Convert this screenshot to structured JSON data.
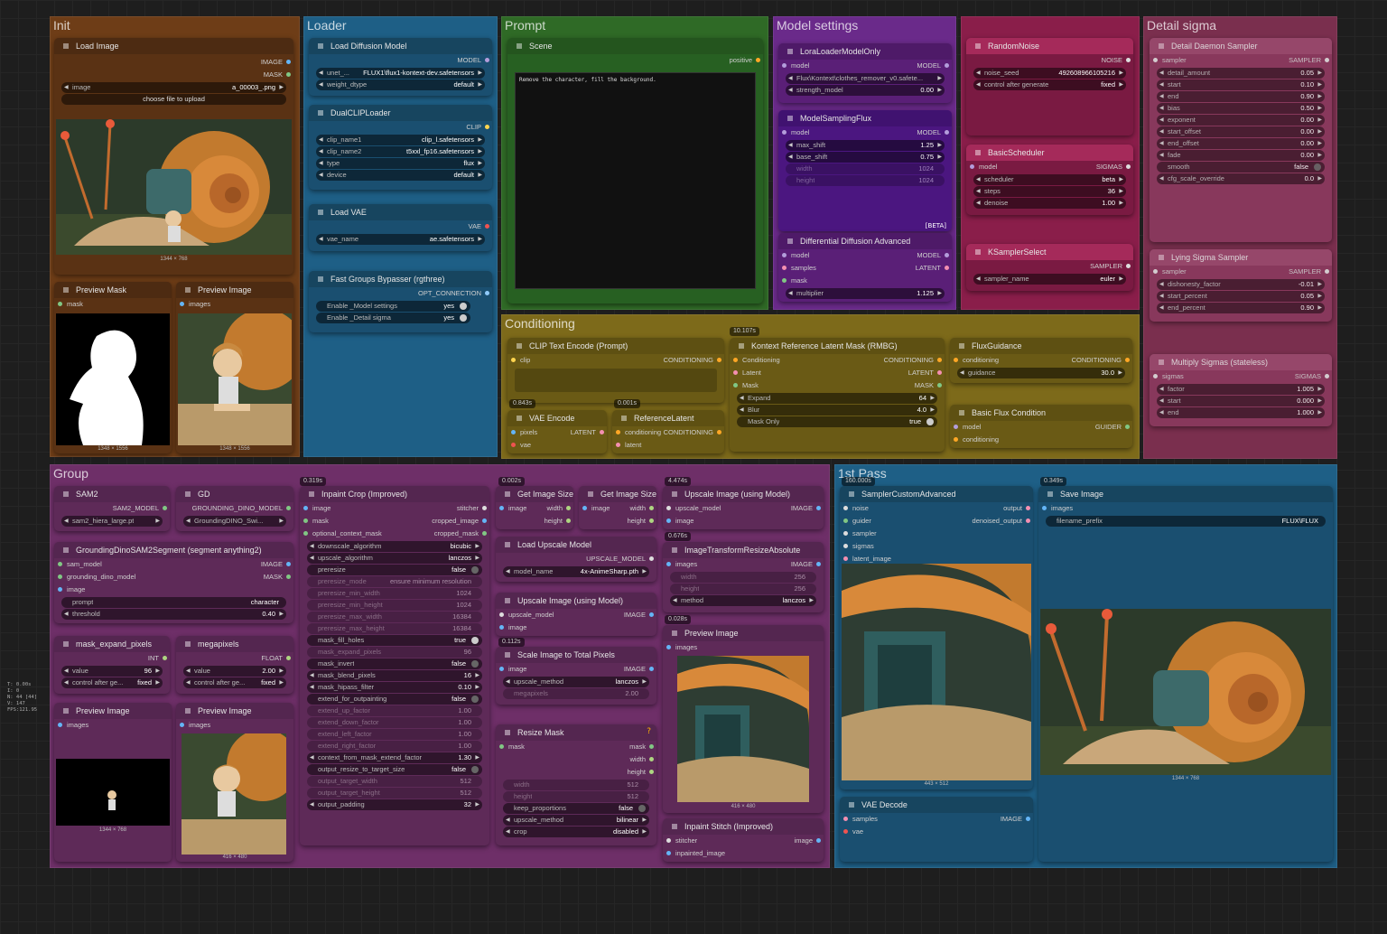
{
  "groups": {
    "init": "Init",
    "loader": "Loader",
    "prompt": "Prompt",
    "model_settings": "Model settings",
    "detail_sigma": "Detail sigma",
    "conditioning": "Conditioning",
    "group": "Group",
    "first_pass": "1st Pass"
  },
  "nodes": {
    "load_image": {
      "title": "Load Image",
      "out1": "IMAGE",
      "out2": "MASK",
      "image_key": "image",
      "image_val": "a_00003_.png",
      "upload": "choose file to upload",
      "cap": "1344 × 768"
    },
    "preview_mask": {
      "title": "Preview Mask",
      "in": "mask",
      "cap": "1348 × 1556"
    },
    "preview_image_init": {
      "title": "Preview Image",
      "in": "images",
      "cap": "1348 × 1556"
    },
    "load_diffusion": {
      "title": "Load Diffusion Model",
      "out": "MODEL",
      "w1k": "unet_...",
      "w1v": "FLUX1\\flux1-kontext-dev.safetensors",
      "w2k": "weight_dtype",
      "w2v": "default"
    },
    "dual_clip": {
      "title": "DualCLIPLoader",
      "out": "CLIP",
      "w1k": "clip_name1",
      "w1v": "clip_l.safetensors",
      "w2k": "clip_name2",
      "w2v": "t5xxl_fp16.safetensors",
      "w3k": "type",
      "w3v": "flux",
      "w4k": "device",
      "w4v": "default"
    },
    "load_vae": {
      "title": "Load VAE",
      "out": "VAE",
      "w1k": "vae_name",
      "w1v": "ae.safetensors"
    },
    "bypasser": {
      "title": "Fast Groups Bypasser (rgthree)",
      "out": "OPT_CONNECTION",
      "w1k": "Enable _Model settings",
      "w1v": "yes",
      "w2k": "Enable _Detail sigma",
      "w2v": "yes"
    },
    "scene": {
      "title": "Scene",
      "out": "positive",
      "text": "Remove the character, fill the background."
    },
    "lora": {
      "title": "LoraLoaderModelOnly",
      "in": "model",
      "out": "MODEL",
      "w1v": "Flux\\Kontext\\clothes_remover_v0.safete...",
      "w2k": "strength_model",
      "w2v": "0.00"
    },
    "msf": {
      "title": "ModelSamplingFlux",
      "in": "model",
      "out": "MODEL",
      "w1k": "max_shift",
      "w1v": "1.25",
      "w2k": "base_shift",
      "w2v": "0.75",
      "w3k": "width",
      "w3v": "1024",
      "w4k": "height",
      "w4v": "1024",
      "beta": "[BETA]"
    },
    "dda": {
      "title": "Differential Diffusion Advanced",
      "in1": "model",
      "in2": "samples",
      "in3": "mask",
      "out1": "MODEL",
      "out2": "LATENT",
      "w1k": "multiplier",
      "w1v": "1.125"
    },
    "random_noise": {
      "title": "RandomNoise",
      "out": "NOISE",
      "w1k": "noise_seed",
      "w1v": "492608966105216",
      "w2k": "control after generate",
      "w2v": "fixed"
    },
    "basic_sched": {
      "title": "BasicScheduler",
      "in": "model",
      "out": "SIGMAS",
      "w1k": "scheduler",
      "w1v": "beta",
      "w2k": "steps",
      "w2v": "36",
      "w3k": "denoise",
      "w3v": "1.00"
    },
    "ksampler_sel": {
      "title": "KSamplerSelect",
      "out": "SAMPLER",
      "w1k": "sampler_name",
      "w1v": "euler"
    },
    "ddsampler": {
      "title": "Detail Daemon Sampler",
      "in": "sampler",
      "out": "SAMPLER",
      "rows": [
        [
          "detail_amount",
          "0.05"
        ],
        [
          "start",
          "0.10"
        ],
        [
          "end",
          "0.90"
        ],
        [
          "bias",
          "0.50"
        ],
        [
          "exponent",
          "0.00"
        ],
        [
          "start_offset",
          "0.00"
        ],
        [
          "end_offset",
          "0.00"
        ],
        [
          "fade",
          "0.00"
        ]
      ],
      "smooth_k": "smooth",
      "smooth_v": "false",
      "cfg_k": "cfg_scale_override",
      "cfg_v": "0.0"
    },
    "lying": {
      "title": "Lying Sigma Sampler",
      "in": "sampler",
      "out": "SAMPLER",
      "w1k": "dishonesty_factor",
      "w1v": "-0.01",
      "w2k": "start_percent",
      "w2v": "0.05",
      "w3k": "end_percent",
      "w3v": "0.90"
    },
    "mult": {
      "title": "Multiply Sigmas (stateless)",
      "in": "sigmas",
      "out": "SIGMAS",
      "w1k": "factor",
      "w1v": "1.005",
      "w2k": "start",
      "w2v": "0.000",
      "w3k": "end",
      "w3v": "1.000"
    },
    "clip_enc": {
      "title": "CLIP Text Encode (Prompt)",
      "in": "clip",
      "out": "CONDITIONING"
    },
    "vae_enc": {
      "title": "VAE Encode",
      "in1": "pixels",
      "in2": "vae",
      "out": "LATENT"
    },
    "ref_latent": {
      "title": "ReferenceLatent",
      "in1": "conditioning",
      "in2": "latent",
      "out": "CONDITIONING"
    },
    "kontext_mask": {
      "title": "Kontext Reference Latent Mask (RMBG)",
      "in1": "Conditioning",
      "in2": "Latent",
      "in3": "Mask",
      "out1": "CONDITIONING",
      "out2": "LATENT",
      "out3": "MASK",
      "w1k": "Expand",
      "w1v": "64",
      "w2k": "Blur",
      "w2v": "4.0",
      "w3k": "Mask Only",
      "w3v": "true"
    },
    "flux_guid": {
      "title": "FluxGuidance",
      "in": "conditioning",
      "out": "CONDITIONING",
      "w1k": "guidance",
      "w1v": "30.0"
    },
    "basic_flux": {
      "title": "Basic Flux Condition",
      "in1": "model",
      "in2": "conditioning",
      "out": "GUIDER"
    },
    "sam2": {
      "title": "SAM2",
      "out": "SAM2_MODEL",
      "w1v": "sam2_hiera_large.pt"
    },
    "gd": {
      "title": "GD",
      "out": "GROUNDING_DINO_MODEL",
      "w1v": "GroundingDINO_Swi..."
    },
    "gdsam": {
      "title": "GroundingDinoSAM2Segment (segment anything2)",
      "in1": "sam_model",
      "in2": "grounding_dino_model",
      "in3": "image",
      "out1": "IMAGE",
      "out2": "MASK",
      "w1k": "prompt",
      "w1v": "character",
      "w2k": "threshold",
      "w2v": "0.40"
    },
    "mask_expand": {
      "title": "mask_expand_pixels",
      "out": "INT",
      "w1k": "value",
      "w1v": "96",
      "w2k": "control after ge...",
      "w2v": "fixed"
    },
    "megapixels": {
      "title": "megapixels",
      "out": "FLOAT",
      "w1k": "value",
      "w1v": "2.00",
      "w2k": "control after ge...",
      "w2v": "fixed"
    },
    "prev_g1": {
      "title": "Preview Image",
      "in": "images",
      "cap": "1344 × 768"
    },
    "prev_g2": {
      "title": "Preview Image",
      "in": "images",
      "cap": "416 × 480"
    },
    "inpaint_crop": {
      "title": "Inpaint Crop (Improved)",
      "in1": "image",
      "in2": "mask",
      "in3": "optional_context_mask",
      "out1": "stitcher",
      "out2": "cropped_image",
      "out3": "cropped_mask",
      "rows": [
        [
          "downscale_algorithm",
          "bicubic",
          "n"
        ],
        [
          "upscale_algorithm",
          "lanczos",
          "n"
        ],
        [
          "preresize",
          "false",
          "t"
        ],
        [
          "preresize_mode",
          "ensure minimum resolution",
          "d"
        ],
        [
          "preresize_min_width",
          "1024",
          "d"
        ],
        [
          "preresize_min_height",
          "1024",
          "d"
        ],
        [
          "preresize_max_width",
          "16384",
          "d"
        ],
        [
          "preresize_max_height",
          "16384",
          "d"
        ],
        [
          "mask_fill_holes",
          "true",
          "t"
        ],
        [
          "mask_expand_pixels",
          "96",
          "d"
        ],
        [
          "mask_invert",
          "false",
          "t"
        ],
        [
          "mask_blend_pixels",
          "16",
          "n"
        ],
        [
          "mask_hipass_filter",
          "0.10",
          "n"
        ],
        [
          "extend_for_outpainting",
          "false",
          "t"
        ],
        [
          "extend_up_factor",
          "1.00",
          "d"
        ],
        [
          "extend_down_factor",
          "1.00",
          "d"
        ],
        [
          "extend_left_factor",
          "1.00",
          "d"
        ],
        [
          "extend_right_factor",
          "1.00",
          "d"
        ],
        [
          "context_from_mask_extend_factor",
          "1.30",
          "n"
        ],
        [
          "output_resize_to_target_size",
          "false",
          "t"
        ],
        [
          "output_target_width",
          "512",
          "d"
        ],
        [
          "output_target_height",
          "512",
          "d"
        ],
        [
          "output_padding",
          "32",
          "n"
        ]
      ]
    },
    "gis1": {
      "title": "Get Image Size",
      "in": "image",
      "out1": "width",
      "out2": "height"
    },
    "gis2": {
      "title": "Get Image Size",
      "in": "image",
      "out1": "width",
      "out2": "height"
    },
    "upscale_model": {
      "title": "Upscale Image (using Model)",
      "in1": "upscale_model",
      "in2": "image",
      "out": "IMAGE"
    },
    "load_upscale": {
      "title": "Load Upscale Model",
      "out": "UPSCALE_MODEL",
      "w1k": "model_name",
      "w1v": "4x-AnimeSharp.pth"
    },
    "itra": {
      "title": "ImageTransformResizeAbsolute",
      "in": "images",
      "out": "IMAGE",
      "w1k": "width",
      "w1v": "256",
      "w2k": "height",
      "w2v": "256",
      "w3k": "method",
      "w3v": "lanczos"
    },
    "upscale_model2": {
      "title": "Upscale Image (using Model)",
      "in1": "upscale_model",
      "in2": "image",
      "out": "IMAGE"
    },
    "scale_total": {
      "title": "Scale Image to Total Pixels",
      "in": "image",
      "out": "IMAGE",
      "w1k": "upscale_method",
      "w1v": "lanczos",
      "w2k": "megapixels",
      "w2v": "2.00"
    },
    "prev_g3": {
      "title": "Preview Image",
      "in": "images",
      "cap": "416 × 480"
    },
    "resize_mask": {
      "title": "Resize Mask",
      "in": "mask",
      "out1": "mask",
      "out2": "width",
      "out3": "height",
      "w1k": "width",
      "w1v": "512",
      "w2k": "height",
      "w2v": "512",
      "w3k": "keep_proportions",
      "w3v": "false",
      "w4k": "upscale_method",
      "w4v": "bilinear",
      "w5k": "crop",
      "w5v": "disabled",
      "q": "?"
    },
    "inpaint_stitch": {
      "title": "Inpaint Stitch (Improved)",
      "in1": "stitcher",
      "in2": "inpainted_image",
      "out": "image"
    },
    "sca": {
      "title": "SamplerCustomAdvanced",
      "in1": "noise",
      "in2": "guider",
      "in3": "sampler",
      "in4": "sigmas",
      "in5": "latent_image",
      "out1": "output",
      "out2": "denoised_output",
      "cap": "443 × 512"
    },
    "vae_dec": {
      "title": "VAE Decode",
      "in1": "samples",
      "in2": "vae",
      "out": "IMAGE"
    },
    "save": {
      "title": "Save Image",
      "in": "images",
      "w1k": "filename_prefix",
      "w1v": "FLUX\\FLUX",
      "cap": "1344 × 768"
    }
  },
  "badges": {
    "b1": "10.107s",
    "b2": "0.843s",
    "b3": "0.001s",
    "b4": "0.319s",
    "b5": "0.002s",
    "b6": "4.474s",
    "b7": "0.676s",
    "b8": "0.028s",
    "b9": "0.112s",
    "b10": "160.000s",
    "b11": "0.349s"
  },
  "stats": [
    "T: 0.00s",
    "I: 0",
    "N: 44 [44]",
    "V: 147",
    "FPS:121.95"
  ],
  "colors": {
    "init": "#6e3d17",
    "loader": "#1e5f86",
    "prompt": "#2f6a26",
    "model": "#6a2a8a",
    "random": "#8a1e4a",
    "detail": "#7a2f4e",
    "cond": "#7d6a1a",
    "group": "#6e2f68",
    "pass": "#1e5f86"
  }
}
